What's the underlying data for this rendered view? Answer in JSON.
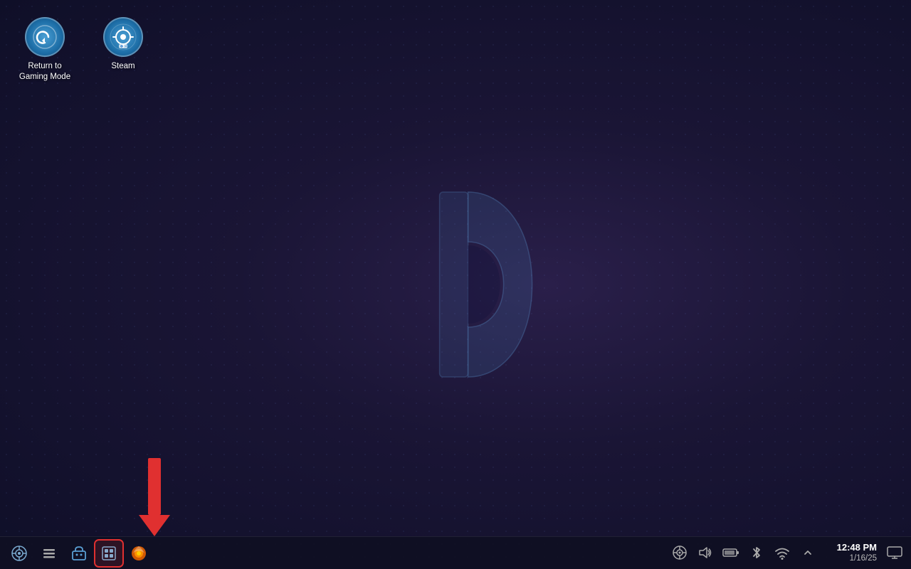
{
  "desktop": {
    "background_colors": [
      "#1a1535",
      "#0f0f28",
      "#2a1f4a"
    ]
  },
  "icons": [
    {
      "id": "return-to-gaming",
      "label": "Return to\nGaming Mode",
      "label_line1": "Return to",
      "label_line2": "Gaming Mode",
      "type": "shortcut"
    },
    {
      "id": "steam",
      "label": "Steam",
      "label_line1": "Steam",
      "label_line2": "",
      "type": "app"
    }
  ],
  "taskbar": {
    "left_buttons": [
      {
        "id": "steamos-btn",
        "icon": "steamos",
        "label": "SteamOS"
      },
      {
        "id": "menu-btn",
        "icon": "menu",
        "label": "Menu"
      },
      {
        "id": "store-btn",
        "icon": "store",
        "label": "Store"
      },
      {
        "id": "discover-btn",
        "icon": "discover",
        "label": "Discover",
        "highlighted": true
      },
      {
        "id": "firefox-btn",
        "icon": "firefox",
        "label": "Firefox"
      }
    ],
    "tray": {
      "steam_icon": "steam",
      "volume_icon": "volume",
      "battery_icon": "battery",
      "bluetooth_icon": "bluetooth",
      "wifi_icon": "wifi",
      "expand_icon": "expand"
    },
    "clock": {
      "time": "12:48 PM",
      "date": "1/16/25"
    }
  },
  "annotation": {
    "arrow_color": "#e03030",
    "highlight_color": "#e03030"
  }
}
